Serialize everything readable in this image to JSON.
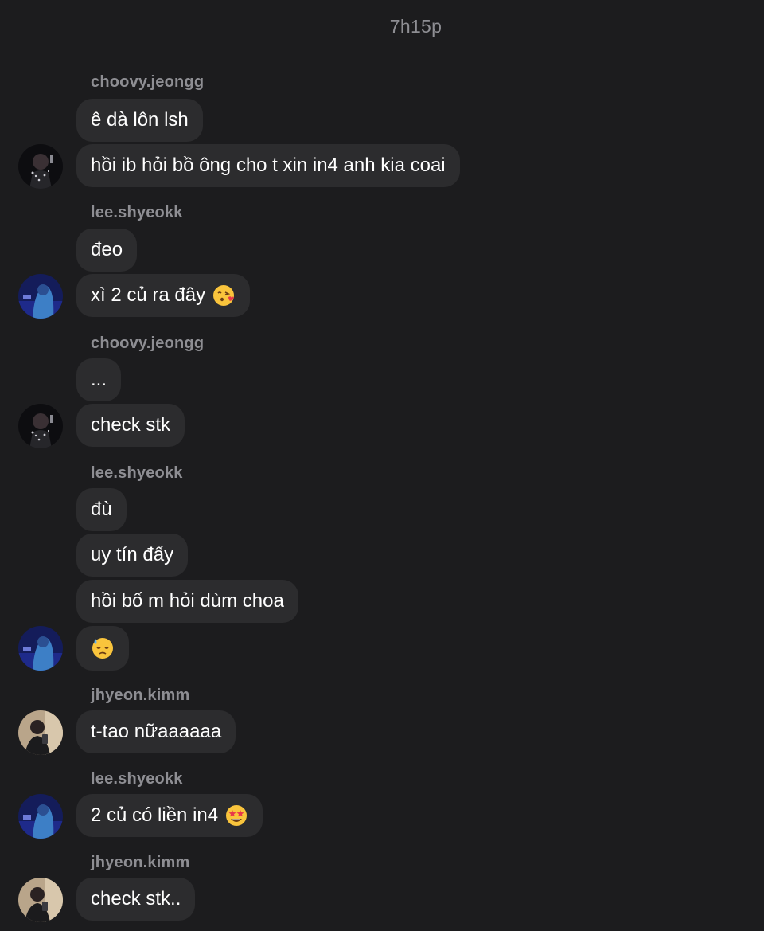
{
  "header": {
    "timestamp": "7h15p"
  },
  "messages": {
    "g1": {
      "sender": "choovy.jeongg",
      "m1": "ê dà lôn lsh",
      "m2": "hồi ib hỏi bồ ông cho t xin in4 anh kia coai"
    },
    "g2": {
      "sender": "lee.shyeokk",
      "m1": "đeo",
      "m2": "xì 2 củ ra đây",
      "m2_emoji": "face-blowing-kiss-emoji"
    },
    "g3": {
      "sender": "choovy.jeongg",
      "m1": "...",
      "m2": "check stk"
    },
    "g4": {
      "sender": "lee.shyeokk",
      "m1": "đù",
      "m2": "uy tín đấy",
      "m3": "hồi bố m hỏi dùm choa",
      "m4_emoji": "downcast-face-with-sweat-emoji"
    },
    "g5": {
      "sender": "jhyeon.kimm",
      "m1": "t-tao nữaaaaaa"
    },
    "g6": {
      "sender": "lee.shyeokk",
      "m1": "2 củ có liền in4",
      "m1_emoji": "star-struck-emoji"
    },
    "g7": {
      "sender": "jhyeon.kimm",
      "m1": "check stk.."
    }
  },
  "colors": {
    "background": "#1c1c1e",
    "bubble": "#2c2c2e",
    "username": "#8e8e93",
    "text": "#ffffff"
  }
}
